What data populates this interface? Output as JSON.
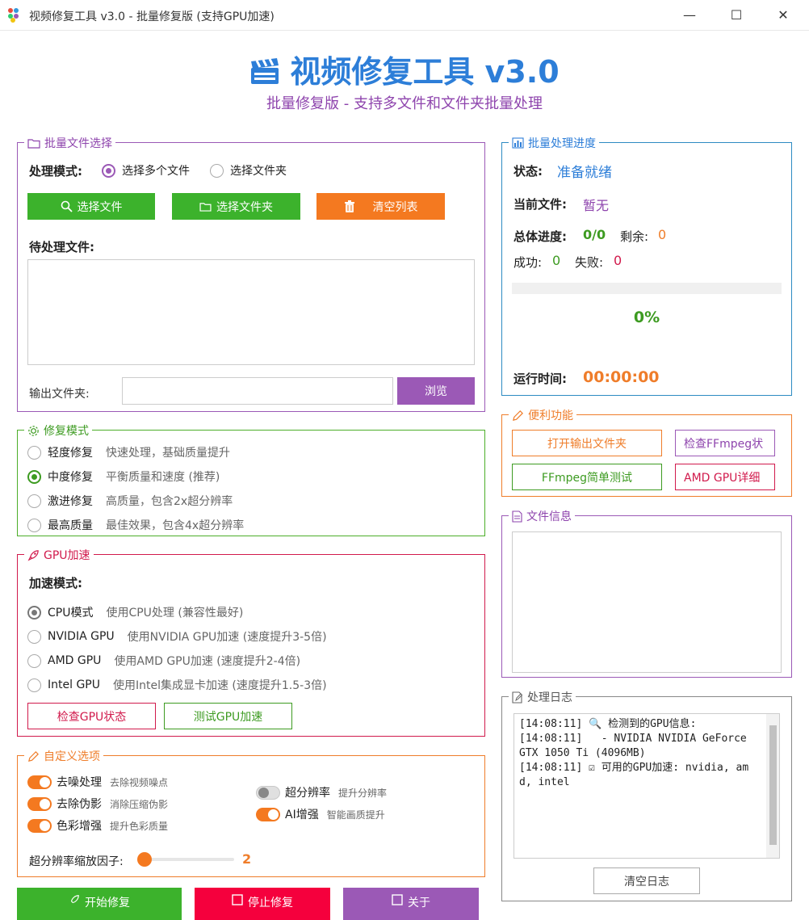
{
  "window": {
    "title": "视频修复工具 v3.0 - 批量修复版 (支持GPU加速)",
    "minimize": "—",
    "maximize": "☐",
    "close": "✕"
  },
  "header": {
    "title": "视频修复工具 v3.0",
    "subtitle": "批量修复版 - 支持多文件和文件夹批量处理"
  },
  "file_select": {
    "title": "批量文件选择",
    "mode_label": "处理模式:",
    "mode_multi": "选择多个文件",
    "mode_folder": "选择文件夹",
    "selected_mode": "multi",
    "btn_select_files": "选择文件",
    "btn_select_folder": "选择文件夹",
    "btn_clear_list": "清空列表",
    "pending_label": "待处理文件:",
    "output_label": "输出文件夹:",
    "output_value": "",
    "btn_browse": "浏览"
  },
  "repair_mode": {
    "title": "修复模式",
    "options": [
      {
        "name": "轻度修复",
        "desc": "快速处理，基础质量提升"
      },
      {
        "name": "中度修复",
        "desc": "平衡质量和速度 (推荐)"
      },
      {
        "name": "激进修复",
        "desc": "高质量，包含2x超分辨率"
      },
      {
        "name": "最高质量",
        "desc": "最佳效果，包含4x超分辨率"
      }
    ],
    "selected_index": 1
  },
  "gpu": {
    "title": "GPU加速",
    "mode_label": "加速模式:",
    "options": [
      {
        "name": "CPU模式",
        "desc": "使用CPU处理 (兼容性最好)"
      },
      {
        "name": "NVIDIA GPU",
        "desc": "使用NVIDIA GPU加速 (速度提升3-5倍)"
      },
      {
        "name": "AMD GPU",
        "desc": "使用AMD GPU加速 (速度提升2-4倍)"
      },
      {
        "name": "Intel GPU",
        "desc": "使用Intel集成显卡加速 (速度提升1.5-3倍)"
      }
    ],
    "selected_index": 0,
    "btn_check": "检查GPU状态",
    "btn_test": "测试GPU加速"
  },
  "custom": {
    "title": "自定义选项",
    "toggles": [
      {
        "name": "去噪处理",
        "hint": "去除视频噪点",
        "on": true
      },
      {
        "name": "去除伪影",
        "hint": "消除压缩伪影",
        "on": true
      },
      {
        "name": "色彩增强",
        "hint": "提升色彩质量",
        "on": true
      },
      {
        "name": "超分辨率",
        "hint": "提升分辨率",
        "on": false
      },
      {
        "name": "AI增强",
        "hint": "智能画质提升",
        "on": true
      }
    ],
    "scale_label": "超分辨率缩放因子:",
    "scale_value": "2",
    "scale_fraction": 0.0
  },
  "bottom_buttons": {
    "start": "开始修复",
    "stop": "停止修复",
    "about": "关于"
  },
  "progress": {
    "title": "批量处理进度",
    "status_label": "状态:",
    "status_value": "准备就绪",
    "current_label": "当前文件:",
    "current_value": "暂无",
    "total_label": "总体进度:",
    "total_value": "0/0",
    "remaining_label": "剩余:",
    "remaining_value": "0",
    "success_label": "成功:",
    "success_value": "0",
    "fail_label": "失败:",
    "fail_value": "0",
    "percent": "0%",
    "fraction": 0.0,
    "runtime_label": "运行时间:",
    "runtime_value": "00:00:00"
  },
  "convenience": {
    "title": "便利功能",
    "btn_open_output": "打开输出文件夹",
    "btn_check_ffmpeg": "检查FFmpeg状",
    "btn_ffmpeg_test": "FFmpeg简单测试",
    "btn_amd_detail": "AMD GPU详细"
  },
  "file_info": {
    "title": "文件信息"
  },
  "log": {
    "title": "处理日志",
    "lines": [
      "[14:08:11] 🔍 检测到的GPU信息:",
      "[14:08:11]   - NVIDIA NVIDIA GeForce GTX 1050 Ti (4096MB)",
      "[14:08:11] ☑ 可用的GPU加速: nvidia, amd, intel"
    ],
    "btn_clear": "清空日志"
  },
  "colors": {
    "blue": "#2d7ed8",
    "purple": "#9b59b6",
    "green": "#3cb22c",
    "orange": "#f47920",
    "red": "#d11a4c"
  }
}
